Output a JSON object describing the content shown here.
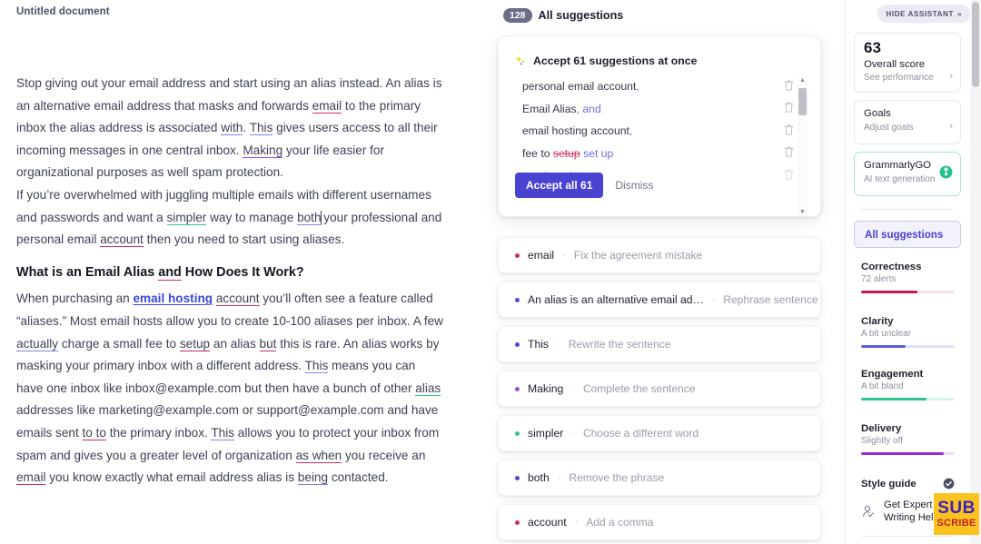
{
  "document": {
    "title": "Untitled document",
    "paragraph1": [
      {
        "t": "Stop giving out your email address and start using an alias instead. An alias is an alternative email address that masks and forwards "
      },
      {
        "t": "email",
        "u": "red"
      },
      {
        "t": " to the primary inbox the alias address is associated "
      },
      {
        "t": "with",
        "u": "blue"
      },
      {
        "t": ". "
      },
      {
        "t": "This",
        "u": "blue"
      },
      {
        "t": " gives users access to all their incoming messages in one central inbox. "
      },
      {
        "t": "Making",
        "u": "purple"
      },
      {
        "t": " your life easier for organizational purposes as well spam protection."
      }
    ],
    "paragraph2": [
      {
        "t": "If you’re overwhelmed with juggling multiple emails with different usernames and passwords and want a "
      },
      {
        "t": "simpler",
        "u": "green"
      },
      {
        "t": " way to manage "
      },
      {
        "t": "both",
        "u": "blue",
        "caret": true
      },
      {
        "t": " your professional and personal email "
      },
      {
        "t": "account",
        "u": "red"
      },
      {
        "t": " then you need to start using aliases."
      }
    ],
    "heading": [
      {
        "t": "What is an Email Alias "
      },
      {
        "t": "and",
        "u": "red"
      },
      {
        "t": " How Does It Work?"
      }
    ],
    "paragraph3": [
      {
        "t": "When purchasing an "
      },
      {
        "t": "email hosting",
        "link": true
      },
      {
        "t": " "
      },
      {
        "t": "account",
        "u": "red"
      },
      {
        "t": " you’ll often see a feature called “aliases.” Most email hosts allow you to create 10-100 aliases per inbox. A few "
      },
      {
        "t": "actually",
        "u": "blue"
      },
      {
        "t": " charge a small fee to "
      },
      {
        "t": "setup",
        "u": "red"
      },
      {
        "t": " an alias "
      },
      {
        "t": "but",
        "u": "red"
      },
      {
        "t": " this is rare. An alias works by masking your primary inbox with a different address. "
      },
      {
        "t": "This",
        "u": "blue"
      },
      {
        "t": " means you can have one inbox like inbox@example.com but then have a bunch of other "
      },
      {
        "t": "alias",
        "u": "green"
      },
      {
        "t": " addresses like marketing@example.com or support@example.com and have emails sent "
      },
      {
        "t": "to to",
        "u": "red"
      },
      {
        "t": " the primary inbox. "
      },
      {
        "t": "This",
        "u": "blue"
      },
      {
        "t": " allows you to protect your inbox from spam and gives you a greater level of organization "
      },
      {
        "t": "as when",
        "u": "red"
      },
      {
        "t": " you receive an "
      },
      {
        "t": "email",
        "u": "red"
      },
      {
        "t": " you know exactly what email address alias is "
      },
      {
        "t": "being",
        "u": "blue"
      },
      {
        "t": " contacted."
      }
    ]
  },
  "suggestions_panel": {
    "count_badge": "128",
    "header_label": "All suggestions",
    "accept_card": {
      "icon": "sparkle-icon",
      "title": "Accept 61 suggestions at once",
      "rows": [
        {
          "text": "personal email account",
          "comma": ",",
          "faded": false
        },
        {
          "text": "Email Alias",
          "comma": ", and",
          "faded": false
        },
        {
          "text": "email hosting account",
          "comma": ",",
          "faded": false
        },
        {
          "text": "fee to ",
          "strike": "setup",
          "replacement": " set up",
          "faded": false
        },
        {
          "text": "an alias ,  but",
          "faded": true
        }
      ],
      "accept_button": "Accept all 61",
      "dismiss_button": "Dismiss"
    },
    "cards": [
      {
        "word": "email",
        "sep": "·",
        "desc": "Fix the agreement mistake",
        "color": "#c8325a"
      },
      {
        "word": "An alias is an alternative email ad…",
        "sep": "·",
        "desc": "Rephrase sentence",
        "color": "#4c4bd6"
      },
      {
        "word": "This",
        "sep": "·",
        "desc": "Rewrite the sentence",
        "color": "#4c4bd6"
      },
      {
        "word": "Making",
        "sep": "·",
        "desc": "Complete the sentence",
        "color": "#9b4ed8"
      },
      {
        "word": "simpler",
        "sep": "·",
        "desc": "Choose a different word",
        "color": "#31c48d"
      },
      {
        "word": "both",
        "sep": "·",
        "desc": "Remove the phrase",
        "color": "#4c4bd6"
      },
      {
        "word": "account",
        "sep": "·",
        "desc": "Add a comma",
        "color": "#c8325a"
      }
    ]
  },
  "assistant": {
    "hide_button": "HIDE ASSISTANT",
    "hide_button_icon": "chevron-double-right-icon",
    "score_card": {
      "score": "63",
      "title": "Overall score",
      "subtitle": "See performance",
      "chevron": "›"
    },
    "goals_card": {
      "title": "Goals",
      "subtitle": "Adjust goals",
      "chevron": "›"
    },
    "grammarly_go_card": {
      "title": "GrammarlyGO",
      "subtitle": "AI text generation",
      "icon": "lightbulb-icon"
    },
    "all_suggestions_button": "All suggestions",
    "metrics": [
      {
        "name": "Correctness",
        "value": "72 alerts",
        "pct": 60,
        "color": "#c8174a",
        "track": "#fadfe6"
      },
      {
        "name": "Clarity",
        "value": "A bit unclear",
        "pct": 48,
        "color": "#5b59e0",
        "track": "#dfe2fa"
      },
      {
        "name": "Engagement",
        "value": "A bit bland",
        "pct": 70,
        "color": "#2bc48a",
        "track": "#d7f5e9"
      },
      {
        "name": "Delivery",
        "value": "Slightly off",
        "pct": 88,
        "color": "#9b29d8",
        "track": "#f2dcfa"
      }
    ],
    "style_guide": {
      "label": "Style guide",
      "icon": "check-circle-icon"
    },
    "expert": {
      "line1": "Get Expert",
      "line2": "Writing Help",
      "icon": "person-check-icon"
    }
  },
  "overlay_badge": {
    "line1": "SUB",
    "line2": "SCRIBE"
  }
}
